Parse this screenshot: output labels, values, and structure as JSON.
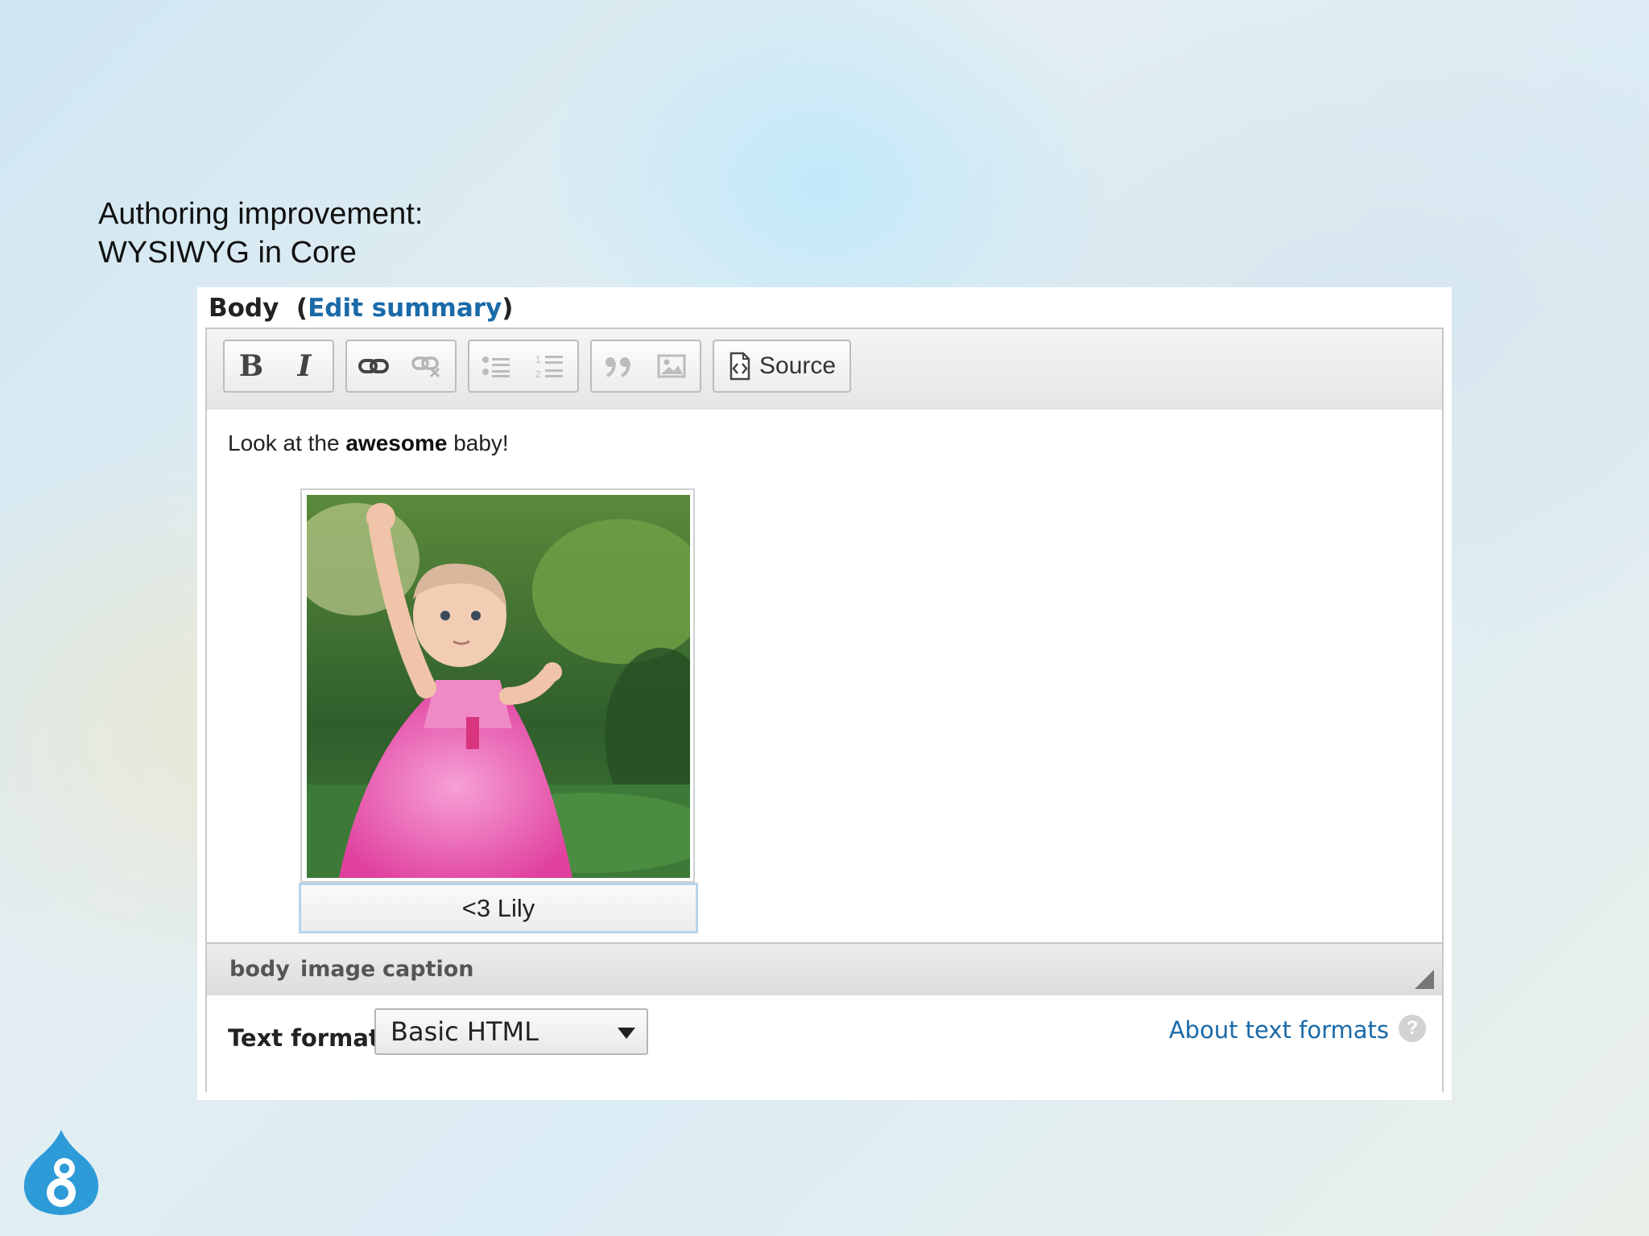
{
  "slide": {
    "title_line1": "Authoring improvement:",
    "title_line2": "WYSIWYG in Core"
  },
  "field": {
    "label": "Body",
    "open_paren": "(",
    "edit_summary_link": "Edit summary",
    "close_paren": ")"
  },
  "toolbar": {
    "bold_label": "B",
    "italic_label": "I",
    "source_label": "Source",
    "icons": [
      "bold",
      "italic",
      "link-icon",
      "unlink-icon",
      "bulleted-list-icon",
      "numbered-list-icon",
      "blockquote-icon",
      "image-icon",
      "source-icon"
    ]
  },
  "content": {
    "text_before": "Look at the ",
    "text_bold": "awesome",
    "text_after": " baby!",
    "image_caption": "<3 Lily"
  },
  "path": {
    "items": [
      "body",
      "image",
      "caption"
    ]
  },
  "format": {
    "label": "Text format",
    "selected": "Basic HTML",
    "about_link": "About text formats",
    "help_glyph": "?"
  },
  "colors": {
    "link": "#1a6aa8",
    "logo": "#2d9bd8"
  }
}
